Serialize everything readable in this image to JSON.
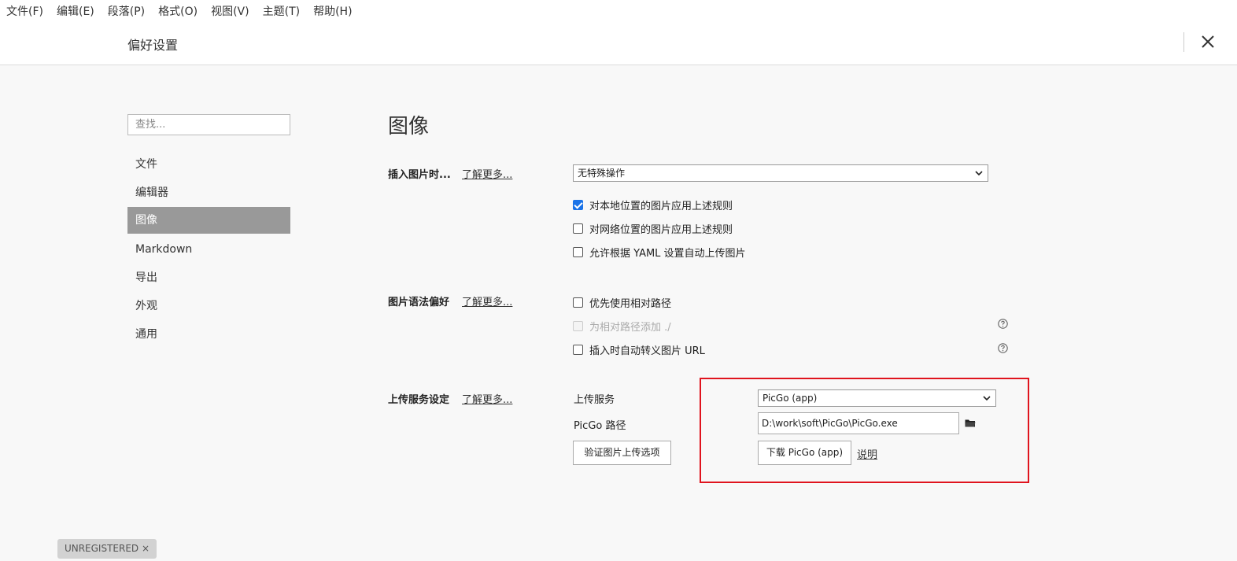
{
  "menubar": {
    "items": [
      "文件(F)",
      "编辑(E)",
      "段落(P)",
      "格式(O)",
      "视图(V)",
      "主题(T)",
      "帮助(H)"
    ]
  },
  "header": {
    "title": "偏好设置"
  },
  "sidebar": {
    "search_placeholder": "查找...",
    "items": [
      {
        "label": "文件"
      },
      {
        "label": "编辑器"
      },
      {
        "label": "图像"
      },
      {
        "label": "Markdown"
      },
      {
        "label": "导出"
      },
      {
        "label": "外观"
      },
      {
        "label": "通用"
      }
    ],
    "active_index": 2
  },
  "main": {
    "title": "图像",
    "insert": {
      "label": "插入图片时...",
      "learn_more": "了解更多...",
      "select_value": "无特殊操作",
      "checkboxes": [
        {
          "label": "对本地位置的图片应用上述规则",
          "checked": true
        },
        {
          "label": "对网络位置的图片应用上述规则",
          "checked": false
        },
        {
          "label": "允许根据 YAML 设置自动上传图片",
          "checked": false
        }
      ]
    },
    "syntax": {
      "label": "图片语法偏好",
      "learn_more": "了解更多...",
      "checkboxes": [
        {
          "label": "优先使用相对路径",
          "checked": false,
          "disabled": false
        },
        {
          "label": "为相对路径添加 ./",
          "checked": false,
          "disabled": true
        },
        {
          "label": "插入时自动转义图片 URL",
          "checked": false,
          "disabled": false
        }
      ]
    },
    "upload": {
      "label": "上传服务设定",
      "learn_more": "了解更多...",
      "service_label": "上传服务",
      "service_value": "PicGo (app)",
      "path_label": "PicGo 路径",
      "path_value": "D:\\work\\soft\\PicGo\\PicGo.exe",
      "verify_button": "验证图片上传选项",
      "download_button": "下载 PicGo (app)",
      "explain_link": "说明"
    }
  },
  "footer": {
    "badge": "UNREGISTERED ×"
  },
  "colors": {
    "accent_checkbox": "#1a73e8",
    "highlight_box": "#e0141e",
    "nav_active_bg": "#999999"
  }
}
